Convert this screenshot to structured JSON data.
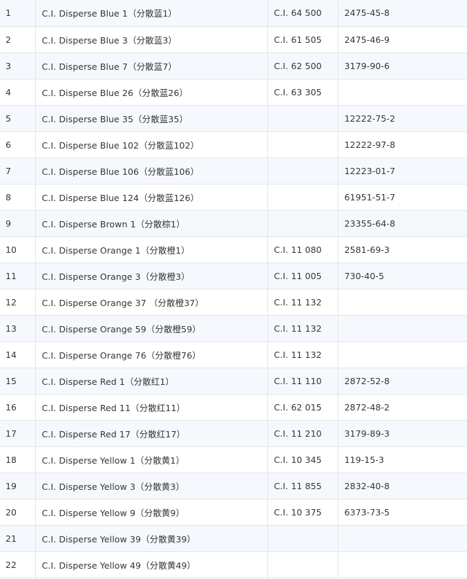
{
  "table": {
    "rows": [
      {
        "no": "1",
        "name": "C.I. Disperse Blue 1（分散蓝1）",
        "ci": "C.I. 64 500",
        "cas": "2475-45-8"
      },
      {
        "no": "2",
        "name": "C.I. Disperse Blue 3（分散蓝3）",
        "ci": "C.I. 61 505",
        "cas": "2475-46-9"
      },
      {
        "no": "3",
        "name": "C.I. Disperse Blue 7（分散蓝7）",
        "ci": "C.I. 62 500",
        "cas": "3179-90-6"
      },
      {
        "no": "4",
        "name": "C.I. Disperse Blue 26（分散蓝26）",
        "ci": "C.I. 63 305",
        "cas": ""
      },
      {
        "no": "5",
        "name": "C.I. Disperse Blue 35（分散蓝35）",
        "ci": "",
        "cas": "12222-75-2"
      },
      {
        "no": "6",
        "name": "C.I. Disperse Blue 102（分散蓝102）",
        "ci": "",
        "cas": "12222-97-8"
      },
      {
        "no": "7",
        "name": "C.I. Disperse Blue 106（分散蓝106）",
        "ci": "",
        "cas": "12223-01-7"
      },
      {
        "no": "8",
        "name": "C.I. Disperse Blue 124（分散蓝126）",
        "ci": "",
        "cas": "61951-51-7"
      },
      {
        "no": "9",
        "name": "C.I. Disperse Brown 1（分散棕1）",
        "ci": "",
        "cas": "23355-64-8"
      },
      {
        "no": "10",
        "name": "C.I. Disperse Orange 1（分散橙1）",
        "ci": "C.I. 11 080",
        "cas": "2581-69-3"
      },
      {
        "no": "11",
        "name": "C.I. Disperse Orange 3（分散橙3）",
        "ci": "C.I. 11 005",
        "cas": "730-40-5"
      },
      {
        "no": "12",
        "name": "C.I. Disperse Orange 37 （分散橙37）",
        "ci": "C.I. 11 132",
        "cas": ""
      },
      {
        "no": "13",
        "name": "C.I. Disperse Orange 59（分散橙59）",
        "ci": "C.I. 11 132",
        "cas": ""
      },
      {
        "no": "14",
        "name": "C.I. Disperse Orange 76（分散橙76）",
        "ci": "C.I. 11 132",
        "cas": ""
      },
      {
        "no": "15",
        "name": "C.I. Disperse Red 1（分散红1）",
        "ci": "C.I. 11 110",
        "cas": "2872-52-8"
      },
      {
        "no": "16",
        "name": "C.I. Disperse Red 11（分散红11）",
        "ci": "C.I. 62 015",
        "cas": "2872-48-2"
      },
      {
        "no": "17",
        "name": "C.I. Disperse Red 17（分散红17）",
        "ci": "C.I. 11 210",
        "cas": "3179-89-3"
      },
      {
        "no": "18",
        "name": "C.I. Disperse Yellow 1（分散黄1）",
        "ci": "C.I. 10 345",
        "cas": "119-15-3"
      },
      {
        "no": "19",
        "name": "C.I. Disperse Yellow 3（分散黄3）",
        "ci": "C.I. 11 855",
        "cas": "2832-40-8"
      },
      {
        "no": "20",
        "name": "C.I. Disperse Yellow 9（分散黄9）",
        "ci": "C.I. 10 375",
        "cas": "6373-73-5"
      },
      {
        "no": "21",
        "name": "C.I. Disperse Yellow 39（分散黄39）",
        "ci": "",
        "cas": ""
      },
      {
        "no": "22",
        "name": "C.I. Disperse Yellow 49（分散黄49）",
        "ci": "",
        "cas": ""
      }
    ]
  },
  "colors": {
    "stripe": "#f5f9fe",
    "background": "#ffffff",
    "border": "#e4e4e4",
    "text": "#333333"
  }
}
